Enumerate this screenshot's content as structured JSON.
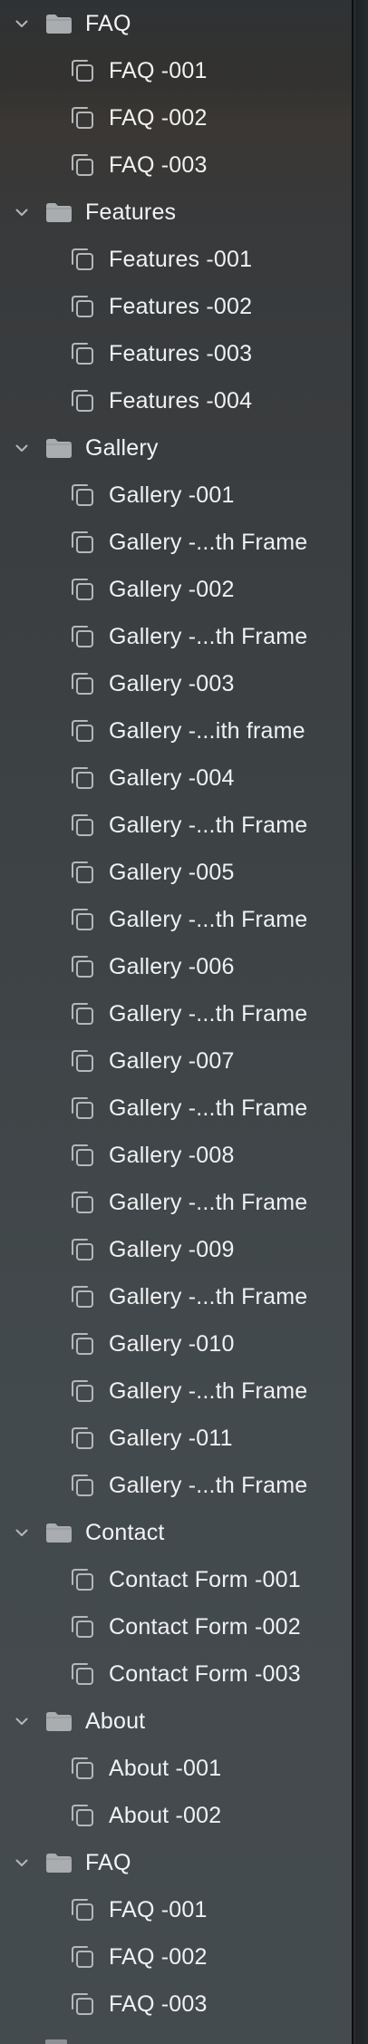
{
  "tree": {
    "groups": [
      {
        "folder": "FAQ",
        "items": [
          "FAQ -001",
          "FAQ -002",
          "FAQ -003"
        ]
      },
      {
        "folder": "Features",
        "items": [
          "Features -001",
          "Features -002",
          "Features -003",
          "Features -004"
        ]
      },
      {
        "folder": "Gallery",
        "items": [
          "Gallery -001",
          "Gallery -...th Frame",
          "Gallery -002",
          "Gallery -...th Frame",
          "Gallery -003",
          "Gallery -...ith frame",
          "Gallery -004",
          "Gallery -...th Frame",
          "Gallery -005",
          "Gallery -...th Frame",
          "Gallery -006",
          "Gallery -...th Frame",
          "Gallery -007",
          "Gallery -...th Frame",
          "Gallery -008",
          "Gallery -...th Frame",
          "Gallery -009",
          "Gallery -...th Frame",
          "Gallery -010",
          "Gallery -...th Frame",
          "Gallery -011",
          "Gallery -...th Frame"
        ]
      },
      {
        "folder": "Contact",
        "items": [
          "Contact Form -001",
          "Contact Form -002",
          "Contact Form -003"
        ]
      },
      {
        "folder": "About",
        "items": [
          "About -001",
          "About -002"
        ]
      },
      {
        "folder": "FAQ",
        "items": [
          "FAQ -001",
          "FAQ -002",
          "FAQ -003"
        ]
      }
    ]
  },
  "icons": {
    "chevron": "chevron-down-icon",
    "folder": "folder-icon",
    "item": "frame-stack-icon"
  },
  "colors": {
    "text": "#f0f1f2",
    "icon": "#b4b8ba",
    "folder": "#a9adaf"
  }
}
